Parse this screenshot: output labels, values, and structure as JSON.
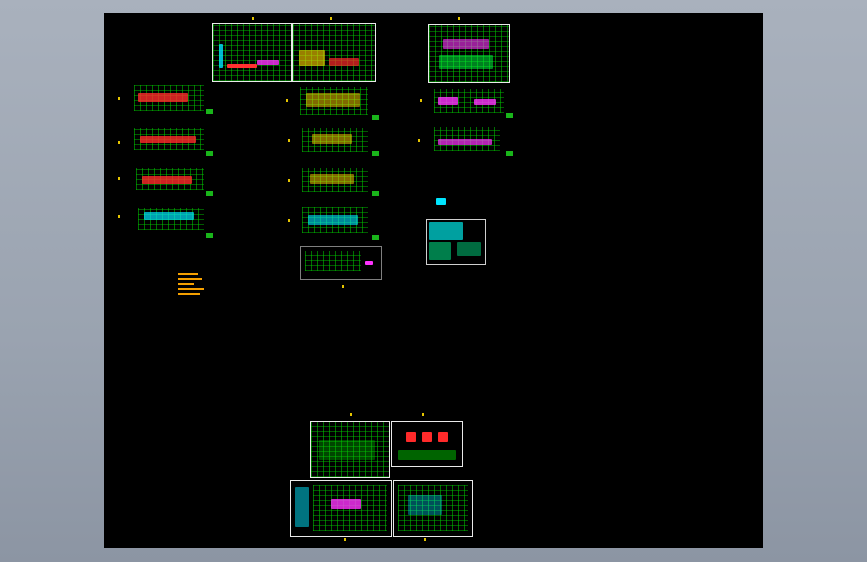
{
  "app": {
    "title": ""
  },
  "colors": {
    "background": "#000000",
    "frame": "#e9e9e9",
    "grid": "#00c800",
    "accent_red": "#ff2a2a",
    "accent_magenta": "#ff33ff",
    "accent_cyan": "#00e5ff",
    "accent_yellow": "#ffd400",
    "note_orange": "#f5a000"
  },
  "sheets": [
    {
      "id": "top-plan-1",
      "kind": "floor-plan"
    },
    {
      "id": "top-plan-2",
      "kind": "floor-plan"
    },
    {
      "id": "top-plan-3",
      "kind": "floor-plan"
    },
    {
      "id": "left-col-1",
      "kind": "floor-plan"
    },
    {
      "id": "left-col-2",
      "kind": "floor-plan"
    },
    {
      "id": "left-col-3",
      "kind": "floor-plan"
    },
    {
      "id": "left-col-4",
      "kind": "floor-plan"
    },
    {
      "id": "mid-col-1",
      "kind": "floor-plan"
    },
    {
      "id": "mid-col-2",
      "kind": "floor-plan"
    },
    {
      "id": "mid-col-3",
      "kind": "floor-plan"
    },
    {
      "id": "mid-col-4",
      "kind": "floor-plan"
    },
    {
      "id": "mid-col-5",
      "kind": "section"
    },
    {
      "id": "right-col-1",
      "kind": "floor-plan"
    },
    {
      "id": "right-col-2",
      "kind": "floor-plan"
    },
    {
      "id": "detail-sheet",
      "kind": "detail"
    },
    {
      "id": "bottom-1",
      "kind": "floor-plan"
    },
    {
      "id": "bottom-2",
      "kind": "detail"
    },
    {
      "id": "bottom-3",
      "kind": "floor-plan"
    },
    {
      "id": "bottom-4",
      "kind": "floor-plan"
    }
  ]
}
